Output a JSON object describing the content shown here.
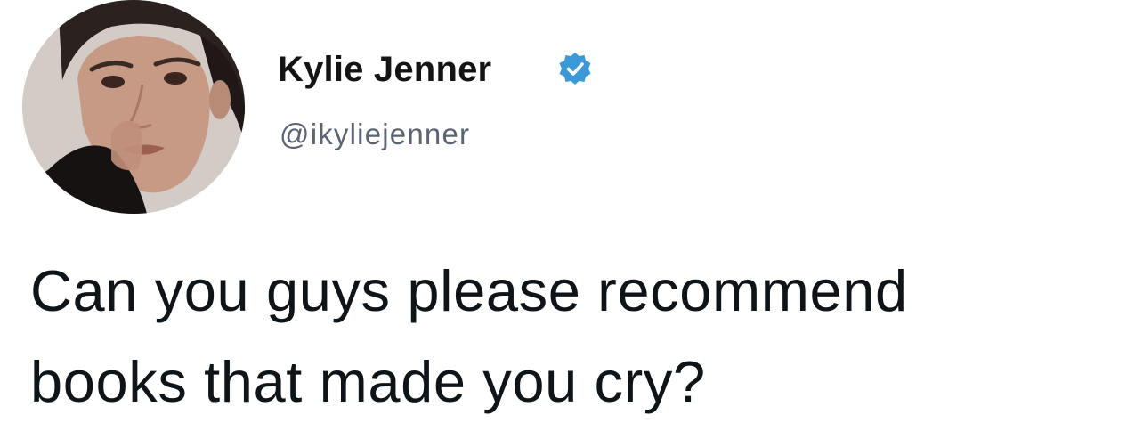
{
  "user": {
    "display_name": "Kylie Jenner",
    "handle": "@ikyliejenner",
    "verified": true,
    "verified_icon": "verified-badge-icon",
    "avatar_icon": "profile-photo"
  },
  "tweet": {
    "lines": [
      "Can you guys please recommend",
      "books that made you cry?"
    ]
  },
  "colors": {
    "verified_badge": "#3b99d8",
    "text_primary": "#0f1419",
    "text_secondary": "#5b6470",
    "background": "#ffffff"
  }
}
